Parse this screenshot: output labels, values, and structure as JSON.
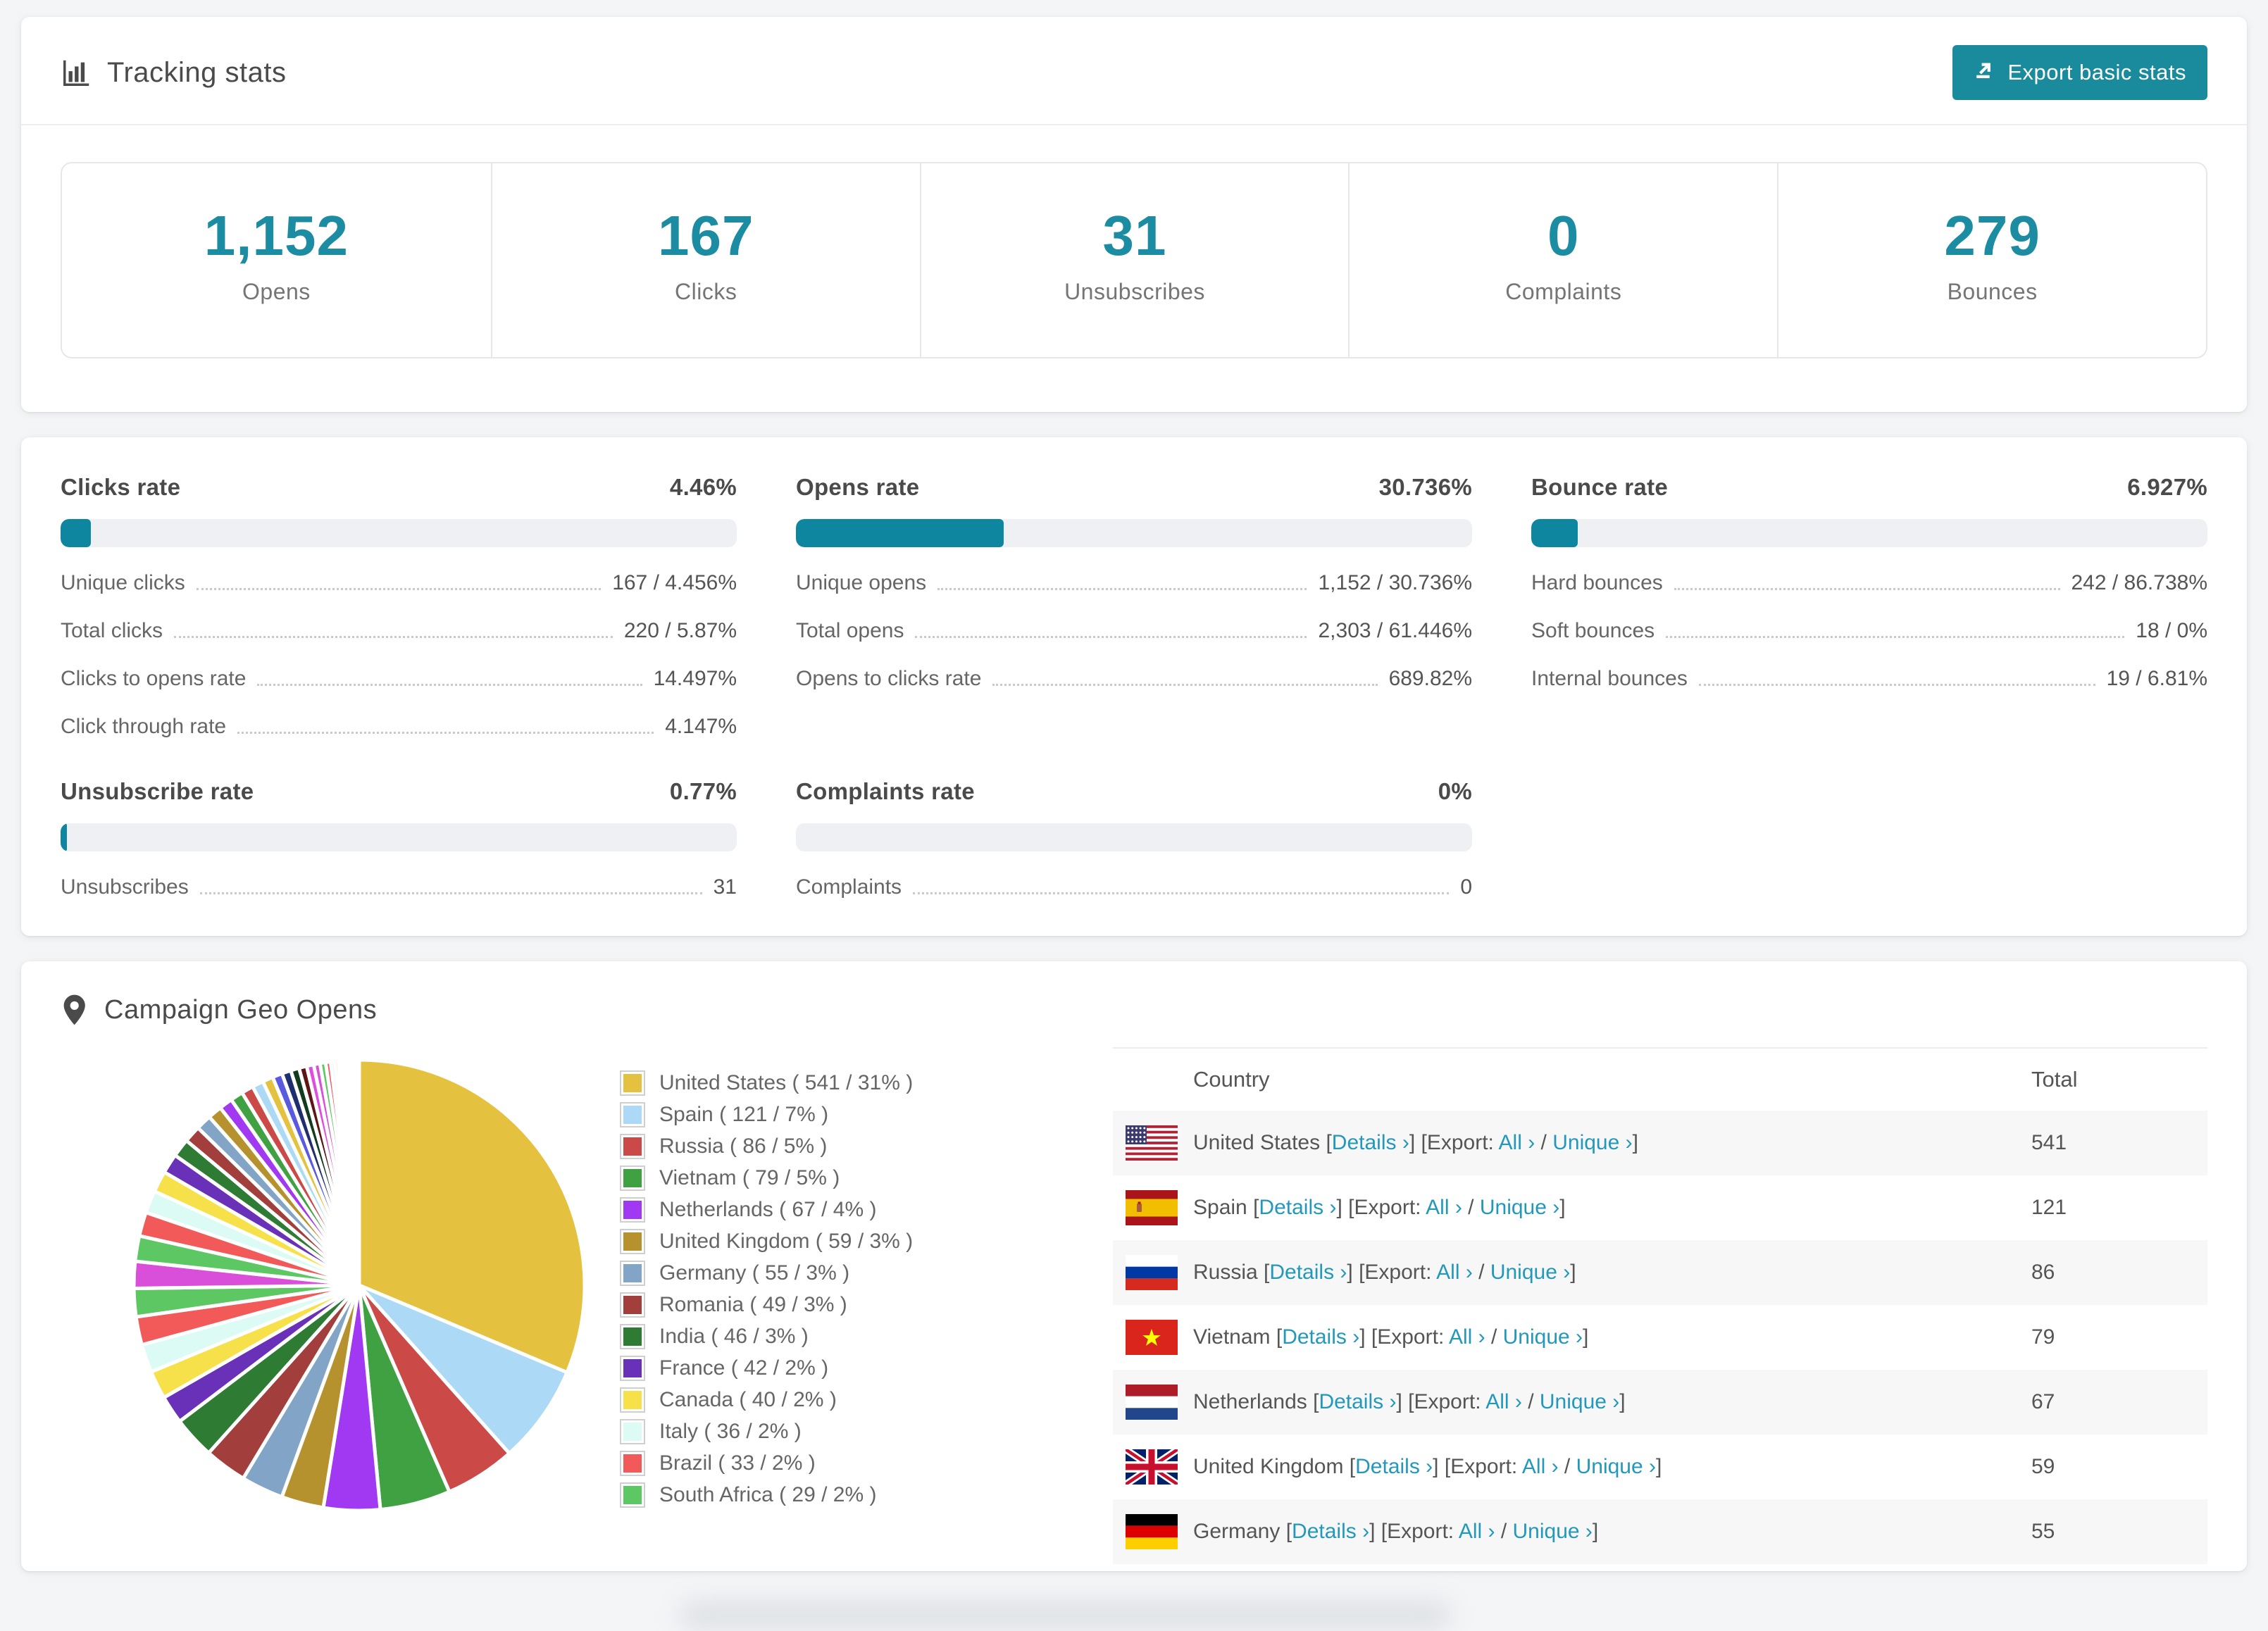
{
  "colors": {
    "accent": "#1a8a9d",
    "number": "#1b8ca1",
    "link": "#2398ba",
    "track": "#eef0f3"
  },
  "tracking": {
    "title": "Tracking stats",
    "export_button": "Export basic stats"
  },
  "summary_stats": [
    {
      "value": "1,152",
      "label": "Opens"
    },
    {
      "value": "167",
      "label": "Clicks"
    },
    {
      "value": "31",
      "label": "Unsubscribes"
    },
    {
      "value": "0",
      "label": "Complaints"
    },
    {
      "value": "279",
      "label": "Bounces"
    }
  ],
  "rate_blocks": [
    {
      "title": "Clicks rate",
      "value": "4.46%",
      "pct": 4.46,
      "items": [
        {
          "label": "Unique clicks",
          "value": "167 / 4.456%"
        },
        {
          "label": "Total clicks",
          "value": "220 / 5.87%"
        },
        {
          "label": "Clicks to opens rate",
          "value": "14.497%"
        },
        {
          "label": "Click through rate",
          "value": "4.147%"
        }
      ]
    },
    {
      "title": "Opens rate",
      "value": "30.736%",
      "pct": 30.736,
      "items": [
        {
          "label": "Unique opens",
          "value": "1,152 / 30.736%"
        },
        {
          "label": "Total opens",
          "value": "2,303 / 61.446%"
        },
        {
          "label": "Opens to clicks rate",
          "value": "689.82%"
        }
      ]
    },
    {
      "title": "Bounce rate",
      "value": "6.927%",
      "pct": 6.927,
      "items": [
        {
          "label": "Hard bounces",
          "value": "242 / 86.738%"
        },
        {
          "label": "Soft bounces",
          "value": "18 / 0%"
        },
        {
          "label": "Internal bounces",
          "value": "19 / 6.81%"
        }
      ]
    },
    {
      "title": "Unsubscribe rate",
      "value": "0.77%",
      "pct": 0.77,
      "items": [
        {
          "label": "Unsubscribes",
          "value": "31"
        }
      ]
    },
    {
      "title": "Complaints rate",
      "value": "0%",
      "pct": 0,
      "items": [
        {
          "label": "Complaints",
          "value": "0"
        }
      ]
    }
  ],
  "geo": {
    "title": "Campaign Geo Opens",
    "table_columns": [
      "Country",
      "Total"
    ],
    "tokens": {
      "lb": " [",
      "mid": "] [",
      "rb": "]",
      "export": "Export: ",
      "slash": " / ",
      "details": "Details ›",
      "all": "All ›",
      "unique": "Unique ›"
    },
    "rows": [
      {
        "country": "United States",
        "flag": "us",
        "total": "541"
      },
      {
        "country": "Spain",
        "flag": "es",
        "total": "121"
      },
      {
        "country": "Russia",
        "flag": "ru",
        "total": "86"
      },
      {
        "country": "Vietnam",
        "flag": "vn",
        "total": "79"
      },
      {
        "country": "Netherlands",
        "flag": "nl",
        "total": "67"
      },
      {
        "country": "United Kingdom",
        "flag": "gb",
        "total": "59"
      },
      {
        "country": "Germany",
        "flag": "de",
        "total": "55"
      }
    ]
  },
  "chart_data": {
    "type": "pie",
    "title": "Campaign Geo Opens",
    "legend_position": "right",
    "slices": [
      {
        "label": "United States",
        "count": "541",
        "pct": "31%",
        "pie": 31,
        "color": "#e4c13f"
      },
      {
        "label": "Spain",
        "count": "121",
        "pct": "7%",
        "pie": 7,
        "color": "#abd9f6"
      },
      {
        "label": "Russia",
        "count": "86",
        "pct": "5%",
        "pie": 5,
        "color": "#cb4a48"
      },
      {
        "label": "Vietnam",
        "count": "79",
        "pct": "5%",
        "pie": 5,
        "color": "#3fa142"
      },
      {
        "label": "Netherlands",
        "count": "67",
        "pct": "4%",
        "pie": 4,
        "color": "#a138f2"
      },
      {
        "label": "United Kingdom",
        "count": "59",
        "pct": "3%",
        "pie": 3,
        "color": "#b6922e"
      },
      {
        "label": "Germany",
        "count": "55",
        "pct": "3%",
        "pie": 3,
        "color": "#82a4c6"
      },
      {
        "label": "Romania",
        "count": "49",
        "pct": "3%",
        "pie": 3,
        "color": "#a23f3c"
      },
      {
        "label": "India",
        "count": "46",
        "pct": "3%",
        "pie": 3,
        "color": "#2e7b33"
      },
      {
        "label": "France",
        "count": "42",
        "pct": "2%",
        "pie": 2,
        "color": "#6831b8"
      },
      {
        "label": "Canada",
        "count": "40",
        "pct": "2%",
        "pie": 2,
        "color": "#f6e14b"
      },
      {
        "label": "Italy",
        "count": "36",
        "pct": "2%",
        "pie": 2,
        "color": "#dcfbf4"
      },
      {
        "label": "Brazil",
        "count": "33",
        "pct": "2%",
        "pie": 2,
        "color": "#f25a5a"
      },
      {
        "label": "South Africa",
        "count": "29",
        "pct": "2%",
        "pie": 2,
        "color": "#5cc763"
      }
    ],
    "tail_values": [
      1.9,
      1.8,
      1.7,
      1.6,
      1.5,
      1.4,
      1.3,
      1.2,
      1.1,
      1.0,
      0.95,
      0.9,
      0.85,
      0.8,
      0.75,
      0.7,
      0.65,
      0.6,
      0.55,
      0.5,
      0.45,
      0.4,
      0.35,
      0.3,
      0.27,
      0.24,
      0.21,
      0.18,
      0.15,
      0.13,
      0.11,
      0.09,
      0.08,
      0.07,
      0.06,
      0.05,
      0.04,
      0.03
    ],
    "tail_palette": [
      "#d94fd9",
      "#5cc763",
      "#f25a5a",
      "#dcfbf4",
      "#f6e14b",
      "#6831b8",
      "#2e7b33",
      "#a23f3c",
      "#82a4c6",
      "#b6922e",
      "#a138f2",
      "#3fa142",
      "#cb4a48",
      "#abd9f6",
      "#e4c13f",
      "#5a5ae0",
      "#1f2e6e",
      "#123c1e",
      "#5e1515",
      "#e04ce0"
    ]
  }
}
